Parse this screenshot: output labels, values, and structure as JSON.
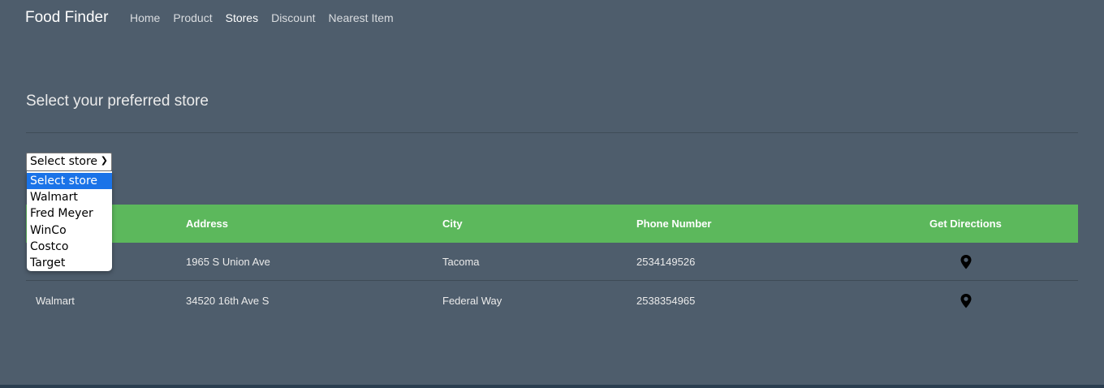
{
  "navbar": {
    "brand": "Food Finder",
    "links": [
      "Home",
      "Product",
      "Stores",
      "Discount",
      "Nearest Item"
    ],
    "active": "Stores"
  },
  "page": {
    "title": "Select your preferred store"
  },
  "store_select": {
    "selected": "Select store",
    "options": [
      "Select store",
      "Walmart",
      "Fred Meyer",
      "WinCo",
      "Costco",
      "Target"
    ],
    "highlighted": "Select store"
  },
  "table": {
    "headers": [
      "Address",
      "City",
      "Phone Number",
      "Get Directions"
    ],
    "rows": [
      {
        "store": "",
        "address": "1965 S Union Ave",
        "city": "Tacoma",
        "phone": "2534149526"
      },
      {
        "store": "Walmart",
        "address": "34520 16th Ave S",
        "city": "Federal Way",
        "phone": "2538354965"
      }
    ],
    "direction_icon": "map-pin-icon"
  },
  "colors": {
    "background": "#4e5d6c",
    "table_header": "#5cb85c",
    "dropdown_highlight": "#1a73e8"
  }
}
